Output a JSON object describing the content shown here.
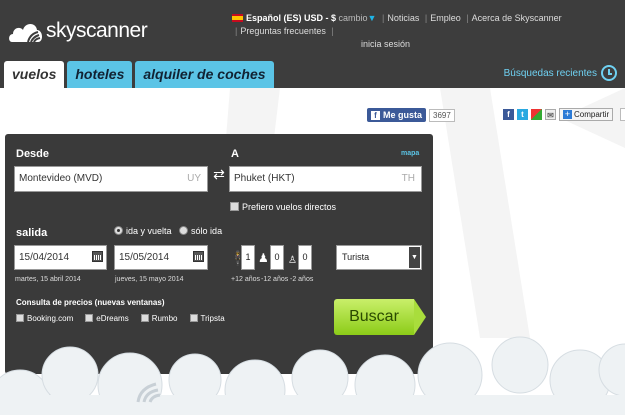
{
  "header": {
    "brand": "skyscanner",
    "locale": "Español (ES) USD - $",
    "cambio": "cambio",
    "links": [
      "Noticias",
      "Empleo",
      "Acerca de Skyscanner",
      "Preguntas frecuentes"
    ],
    "login": "inicia sesión",
    "tabs": [
      "vuelos",
      "hoteles",
      "alquiler de coches"
    ],
    "recent": "Búsquedas recientes"
  },
  "social": {
    "like": "Me gusta",
    "like_count": "3697",
    "share": "Compartir",
    "share_count": "4K"
  },
  "search": {
    "from_label": "Desde",
    "from_value": "Montevideo (MVD)",
    "from_code": "UY",
    "to_label": "A",
    "to_value": "Phuket (HKT)",
    "to_code": "TH",
    "map": "mapa",
    "direct": "Prefiero vuelos directos",
    "depart_label": "salida",
    "trip_round": "ida y vuelta",
    "trip_oneway": "sólo ida",
    "depart_date": "15/04/2014",
    "depart_text": "martes, 15 abril 2014",
    "return_date": "15/05/2014",
    "return_text": "jueves, 15 mayo 2014",
    "adults": "1",
    "children": "0",
    "infants": "0",
    "adults_label": "+12 años",
    "children_label": "-12 años",
    "infants_label": "-2 años",
    "cabin": "Turista",
    "consult": "Consulta de precios (nuevas ventanas)",
    "partners": [
      "Booking.com",
      "eDreams",
      "Rumbo",
      "Tripsta"
    ],
    "button": "Buscar"
  },
  "colors": {
    "header_bg": "#3d3d3d",
    "accent": "#5bc4e6",
    "cta": "#9fd62c"
  }
}
